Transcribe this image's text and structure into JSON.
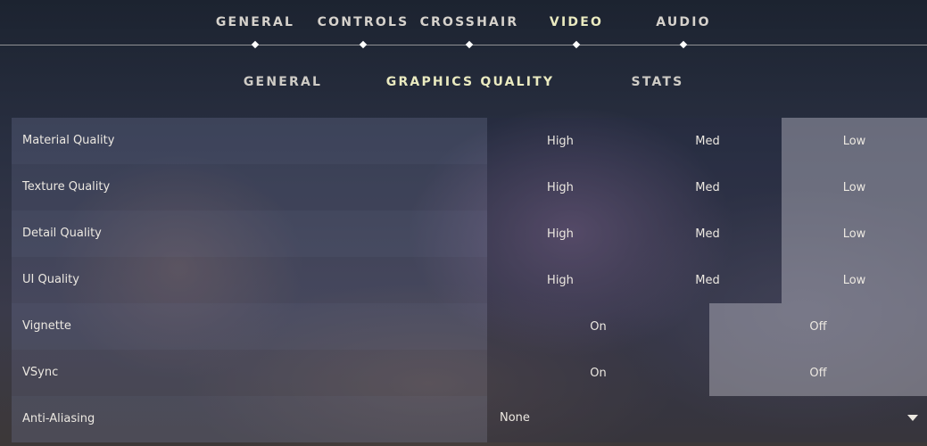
{
  "top_tabs": [
    {
      "label": "GENERAL",
      "active": false
    },
    {
      "label": "CONTROLS",
      "active": false
    },
    {
      "label": "CROSSHAIR",
      "active": false
    },
    {
      "label": "VIDEO",
      "active": true
    },
    {
      "label": "AUDIO",
      "active": false
    }
  ],
  "sub_tabs": [
    {
      "label": "GENERAL",
      "active": false
    },
    {
      "label": "GRAPHICS QUALITY",
      "active": true
    },
    {
      "label": "STATS",
      "active": false
    }
  ],
  "settings": [
    {
      "label": "Material Quality",
      "options": [
        "High",
        "Med",
        "Low"
      ],
      "selected": "Low"
    },
    {
      "label": "Texture Quality",
      "options": [
        "High",
        "Med",
        "Low"
      ],
      "selected": "Low"
    },
    {
      "label": "Detail Quality",
      "options": [
        "High",
        "Med",
        "Low"
      ],
      "selected": "Low"
    },
    {
      "label": "UI Quality",
      "options": [
        "High",
        "Med",
        "Low"
      ],
      "selected": "Low"
    },
    {
      "label": "Vignette",
      "options": [
        "On",
        "Off"
      ],
      "selected": "Off"
    },
    {
      "label": "VSync",
      "options": [
        "On",
        "Off"
      ],
      "selected": "Off"
    },
    {
      "label": "Anti-Aliasing",
      "dropdown_value": "None"
    }
  ],
  "colors": {
    "active_tab": "#eaeac0",
    "text": "#ece8e1"
  }
}
